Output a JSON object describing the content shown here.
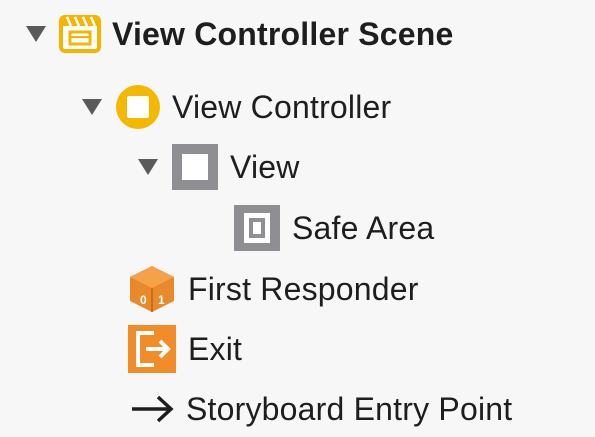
{
  "outline": {
    "scene": {
      "label": "View Controller Scene",
      "expanded": true,
      "icon": "scene-icon"
    },
    "view_controller": {
      "label": "View Controller",
      "expanded": true,
      "icon": "view-controller-icon"
    },
    "view": {
      "label": "View",
      "expanded": true,
      "icon": "view-icon"
    },
    "safe_area": {
      "label": "Safe Area",
      "icon": "safe-area-icon"
    },
    "first_responder": {
      "label": "First Responder",
      "icon": "first-responder-icon"
    },
    "exit": {
      "label": "Exit",
      "icon": "exit-icon"
    },
    "entry_point": {
      "label": "Storyboard Entry Point",
      "icon": "arrow-right-icon"
    }
  },
  "colors": {
    "scene_icon": "#f4b400",
    "view_controller_icon": "#f5b800",
    "view_icon_border": "#8e8e93",
    "first_responder_icon": "#e8892c",
    "exit_icon": "#f28c28",
    "disclosure": "#5a5a5a"
  }
}
